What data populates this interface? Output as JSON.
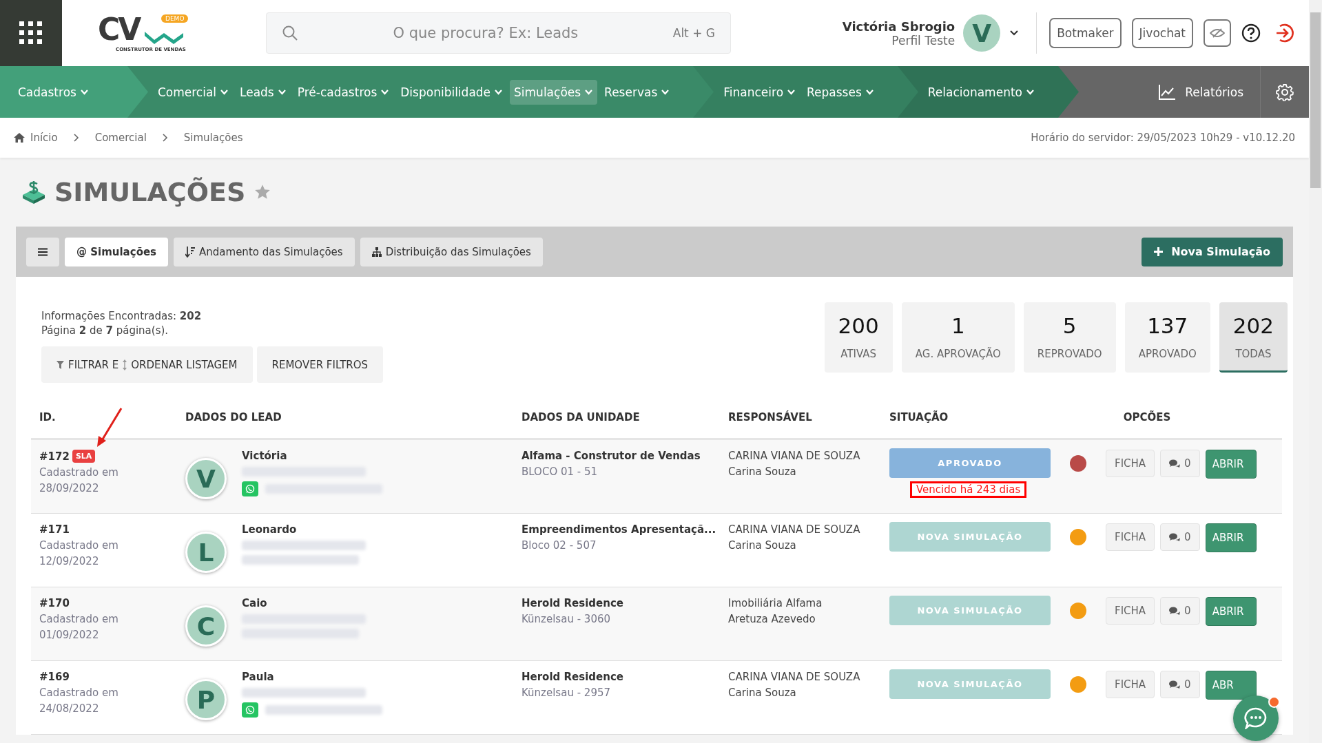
{
  "header": {
    "logo": {
      "letters": "CV",
      "badge": "DEMO",
      "tagline": "CONSTRUTOR DE VENDAS"
    },
    "search": {
      "placeholder": "O que procura? Ex: Leads",
      "shortcut": "Alt + G"
    },
    "user": {
      "name": "Victória Sbrogio",
      "profile": "Perfil Teste",
      "initial": "V"
    },
    "buttons": [
      "Botmaker",
      "Jivochat"
    ]
  },
  "nav": {
    "groups": [
      {
        "items": [
          {
            "label": "Cadastros",
            "selected": false
          }
        ]
      },
      {
        "items": [
          {
            "label": "Comercial",
            "selected": false
          },
          {
            "label": "Leads",
            "selected": false
          },
          {
            "label": "Pré-cadastros",
            "selected": false
          },
          {
            "label": "Disponibilidade",
            "selected": false
          },
          {
            "label": "Simulações",
            "selected": true
          },
          {
            "label": "Reservas",
            "selected": false
          }
        ]
      },
      {
        "items": [
          {
            "label": "Financeiro",
            "selected": false
          },
          {
            "label": "Repasses",
            "selected": false
          }
        ]
      },
      {
        "items": [
          {
            "label": "Relacionamento",
            "selected": false
          }
        ]
      }
    ],
    "reports": "Relatórios"
  },
  "breadcrumb": [
    "Início",
    "Comercial",
    "Simulações"
  ],
  "server_time": "Horário do servidor: 29/05/2023 10h29 - v10.12.20",
  "page": {
    "title": "SIMULAÇÕES",
    "favorite": false
  },
  "tabs": [
    {
      "label": "@ Simulações",
      "kind": "plain",
      "selected": true
    },
    {
      "label": "Andamento das Simulações",
      "kind": "sort",
      "selected": false
    },
    {
      "label": "Distribuição das Simulações",
      "kind": "sitemap",
      "selected": false
    }
  ],
  "new_button": "Nova Simulação",
  "summary": "Informações Encontradas: **202**",
  "pagination": "Página **2** de **7** página(s).",
  "filter_button": {
    "part_1": "FILTRAR E",
    "part_2": "ORDENAR LISTAGEM"
  },
  "remove_button": "REMOVER FILTROS",
  "stats": [
    {
      "count": "200",
      "label": "ATIVAS",
      "selected": false
    },
    {
      "count": "1",
      "label": "AG. APROVAÇÃO",
      "selected": false
    },
    {
      "count": "5",
      "label": "REPROVADO",
      "selected": false
    },
    {
      "count": "137",
      "label": "APROVADO",
      "selected": false
    },
    {
      "count": "202",
      "label": "TODAS",
      "selected": true
    }
  ],
  "table": {
    "columns": [
      "ID.",
      "DADOS DO LEAD",
      "DADOS DA UNIDADE",
      "RESPONSÁVEL",
      "SITUAÇÃO",
      "OPCÕES"
    ],
    "rows": [
      {
        "id": "#172",
        "badge": "SLA",
        "registered": "Cadastrado em",
        "date": "28/09/2022",
        "initial": "V",
        "name": "Victória",
        "whatsapp": true,
        "unit": "Alfama - Construtor de Vendas",
        "unit_detail": "BLOCO 01 - 51",
        "responsible": "CARINA VIANA DE SOUZA",
        "agent": "Carina Souza",
        "status": {
          "label": "APROVADO",
          "kind": "approved"
        },
        "overdue": "Vencido há 243 dias",
        "color": "#b94a48",
        "sheet": "FICHA",
        "comments": "0",
        "open": "ABRIR"
      },
      {
        "id": "#171",
        "registered": "Cadastrado em",
        "date": "12/09/2022",
        "initial": "L",
        "name": "Leonardo",
        "whatsapp": false,
        "unit": "Empreendimentos Apresentaçã...",
        "unit_detail": "Bloco 02 - 507",
        "responsible": "CARINA VIANA DE SOUZA",
        "agent": "Carina Souza",
        "status": {
          "label": "NOVA SIMULAÇÃO",
          "kind": "new"
        },
        "color": "#f39c12",
        "sheet": "FICHA",
        "comments": "0",
        "open": "ABRIR"
      },
      {
        "id": "#170",
        "registered": "Cadastrado em",
        "date": "01/09/2022",
        "initial": "C",
        "name": "Caio",
        "whatsapp": false,
        "unit": "Herold Residence",
        "unit_detail": "Künzelsau - 3060",
        "responsible": "Imobiliária Alfama",
        "agent": "Aretuza Azevedo",
        "status": {
          "label": "NOVA SIMULAÇÃO",
          "kind": "new"
        },
        "color": "#f39c12",
        "sheet": "FICHA",
        "comments": "0",
        "open": "ABRIR"
      },
      {
        "id": "#169",
        "registered": "Cadastrado em",
        "date": "24/08/2022",
        "initial": "P",
        "name": "Paula",
        "whatsapp": true,
        "unit": "Herold Residence",
        "unit_detail": "Künzelsau - 2957",
        "responsible": "CARINA VIANA DE SOUZA",
        "agent": "Carina Souza",
        "status": {
          "label": "NOVA SIMULAÇÃO",
          "kind": "new"
        },
        "color": "#f39c12",
        "sheet": "FICHA",
        "comments": "0",
        "open": "ABR"
      }
    ]
  }
}
